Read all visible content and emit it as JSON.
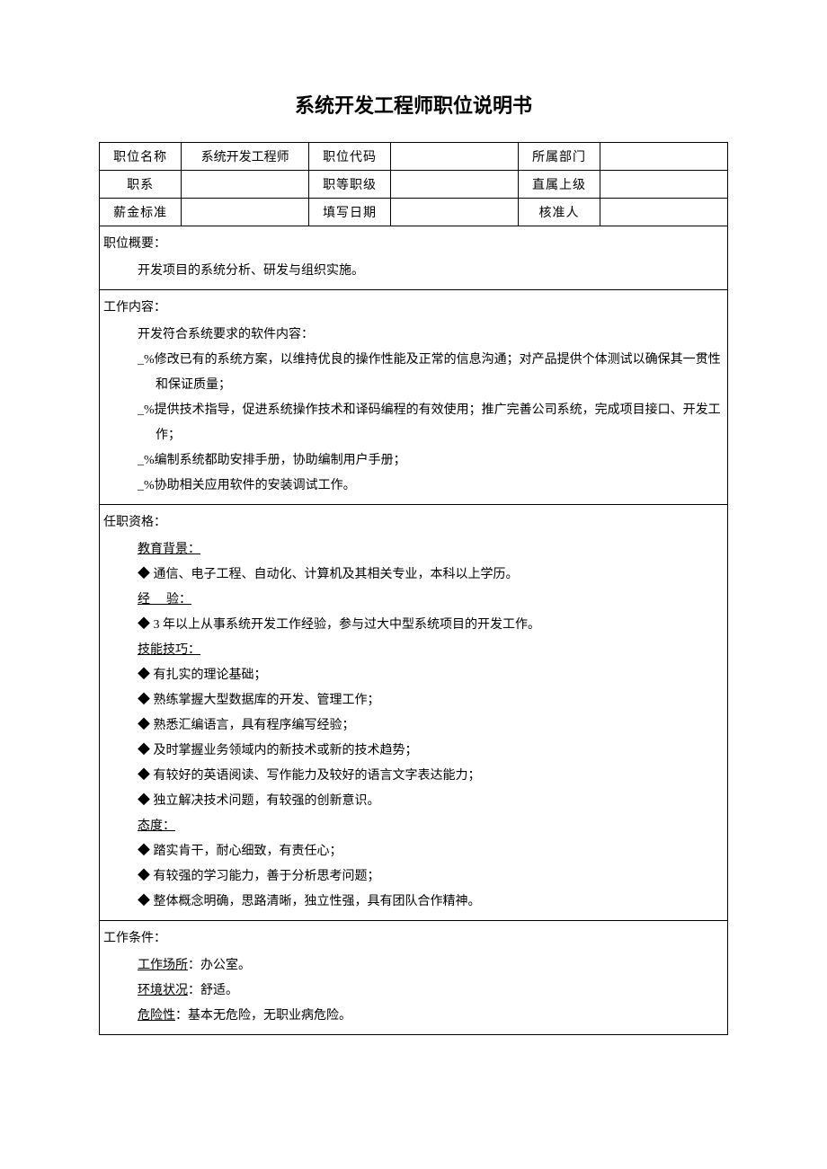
{
  "title": "系统开发工程师职位说明书",
  "header": {
    "r1c1": "职位名称",
    "r1v1": "系统开发工程师",
    "r1c2": "职位代码",
    "r1v2": "",
    "r1c3": "所属部门",
    "r1v3": "",
    "r2c1": "职系",
    "r2v1": "",
    "r2c2": "职等职级",
    "r2v2": "",
    "r2c3": "直属上级",
    "r2v3": "",
    "r3c1": "薪金标准",
    "r3v1": "",
    "r3c2": "填写日期",
    "r3v2": "",
    "r3c3": "核准人",
    "r3v3": ""
  },
  "overview": {
    "label": "职位概要：",
    "text": "开发项目的系统分析、研发与组织实施。"
  },
  "content": {
    "label": "工作内容：",
    "lead": "开发符合系统要求的软件内容：",
    "items": [
      "_%修改已有的系统方案，以维持优良的操作性能及正常的信息沟通；对产品提供个体测试以确保其一贯性和保证质量；",
      "_%提供技术指导，促进系统操作技术和译码编程的有效使用；推广完善公司系统，完成项目接口、开发工作；",
      "_%编制系统都助安排手册，协助编制用户手册；",
      "_%协助相关应用软件的安装调试工作。"
    ]
  },
  "qualification": {
    "label": "任职资格：",
    "edu_label": "教育背景：",
    "edu_text": "◆ 通信、电子工程、自动化、计算机及其相关专业，本科以上学历。",
    "exp_label_pre": "经",
    "exp_label_post": "验：",
    "exp_text": "◆ 3 年以上从事系统开发工作经验，参与过大中型系统项目的开发工作。",
    "skill_label": "技能技巧：",
    "skills": [
      "◆ 有扎实的理论基础；",
      "◆ 熟练掌握大型数据库的开发、管理工作；",
      "◆ 熟悉汇编语言，具有程序编写经验；",
      "◆ 及时掌握业务领域内的新技术或新的技术趋势；",
      "◆ 有较好的英语阅读、写作能力及较好的语言文字表达能力；",
      "◆ 独立解决技术问题，有较强的创新意识。"
    ],
    "attitude_label": "态度：",
    "attitudes": [
      "◆ 踏实肯干，耐心细致，有责任心；",
      "◆ 有较强的学习能力，善于分析思考问题；",
      "◆ 整体概念明确，思路清晰，独立性强，具有团队合作精神。"
    ]
  },
  "conditions": {
    "label": "工作条件：",
    "place_label": "工作场所",
    "place_text": "：办公室。",
    "env_label": "环境状况",
    "env_text": "：舒适。",
    "risk_label": "危险性",
    "risk_text": "：基本无危险，无职业病危险。"
  }
}
